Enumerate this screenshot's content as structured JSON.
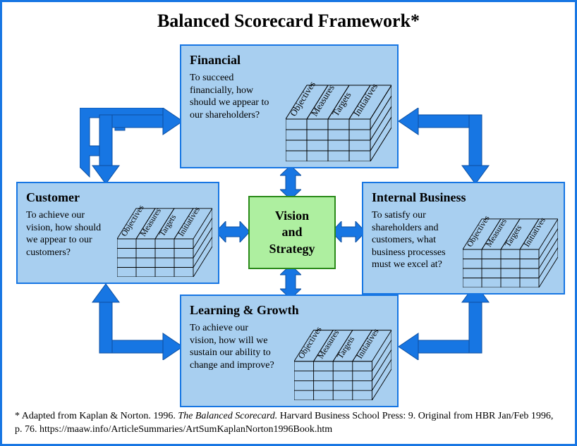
{
  "title": "Balanced Scorecard Framework*",
  "center": {
    "line1": "Vision",
    "line2": "and",
    "line3": "Strategy"
  },
  "perspectives": {
    "financial": {
      "title": "Financial",
      "question": "To succeed financially, how should we appear to our shareholders?"
    },
    "customer": {
      "title": "Customer",
      "question": "To achieve our vision, how should we appear to our customers?"
    },
    "internal": {
      "title": "Internal Business",
      "question": "To satisfy our shareholders and customers, what business processes must we excel at?"
    },
    "learning": {
      "title": "Learning & Growth",
      "question": "To achieve our vision, how will we sustain our ability to change and improve?"
    }
  },
  "table_columns": [
    "Objectives",
    "Measures",
    "Targets",
    "Initiatives"
  ],
  "footnote": {
    "prefix": "* Adapted from Kaplan & Norton. 1996.  ",
    "italic": "The Balanced Scorecard.",
    "suffix": "  Harvard Business School Press: 9.  Original from HBR Jan/Feb 1996, p. 76. https://maaw.info/ArticleSummaries/ArtSumKaplanNorton1996Book.htm"
  },
  "colors": {
    "frame_border": "#1776e3",
    "box_fill": "#a8cff0",
    "center_fill": "#aeefa0",
    "center_border": "#2b8a1a",
    "arrow_fill": "#1776e3",
    "arrow_stroke": "#0d4fa0"
  }
}
